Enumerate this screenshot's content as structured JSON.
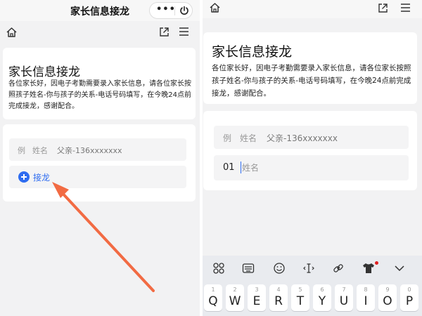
{
  "left": {
    "miniprogram_title": "家长信息接龙",
    "capsule_more": "•••",
    "card": {
      "title": "家长信息接龙",
      "description": "各位家长好，因电子考勤需要录入家长信息，请各位家长按照孩子姓名-你与孩子的关系-电话号码填写，在今晚24点前完成接龙，感谢配合。"
    },
    "example": {
      "label": "例",
      "placeholder": "姓名",
      "text": "父亲-136xxxxxxx"
    },
    "add_label": "接龙"
  },
  "right": {
    "card": {
      "title": "家长信息接龙",
      "description": "各位家长好，因电子考勤需要录入家长信息，请各位家长按照孩子姓名-你与孩子的关系-电话号码填写，在今晚24点前完成接龙，感谢配合。"
    },
    "example": {
      "label": "例",
      "placeholder": "姓名",
      "text": "父亲-136xxxxxxx"
    },
    "entry": {
      "number": "01",
      "placeholder": "姓名",
      "value": ""
    },
    "keyboard": {
      "keys": [
        {
          "digit": "1",
          "letter": "Q"
        },
        {
          "digit": "2",
          "letter": "W"
        },
        {
          "digit": "3",
          "letter": "E"
        },
        {
          "digit": "4",
          "letter": "R"
        },
        {
          "digit": "5",
          "letter": "T"
        },
        {
          "digit": "6",
          "letter": "Y"
        },
        {
          "digit": "7",
          "letter": "U"
        },
        {
          "digit": "8",
          "letter": "I"
        },
        {
          "digit": "9",
          "letter": "O"
        },
        {
          "digit": "0",
          "letter": "P"
        }
      ]
    }
  },
  "colors": {
    "accent": "#2e6cf0",
    "arrow": "#f26b43",
    "background": "#f2f2f3"
  },
  "icons": [
    "home-icon",
    "share-icon",
    "menu-icon",
    "power-icon",
    "grid-icon",
    "keyboard-icon",
    "emoji-icon",
    "cursor-icon",
    "link-icon",
    "skin-icon",
    "chevron-down-icon"
  ]
}
